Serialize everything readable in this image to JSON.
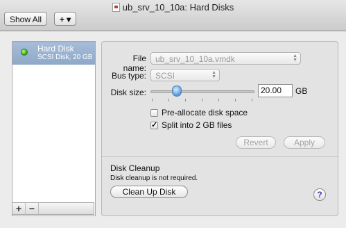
{
  "window": {
    "title": "ub_srv_10_10a: Hard Disks"
  },
  "toolbar": {
    "show_all_label": "Show All",
    "add_label": "+ ▾"
  },
  "sidebar": {
    "items": [
      {
        "name": "Hard Disk",
        "subtitle": "SCSI Disk, 20 GB",
        "status_color": "#3fae1d",
        "selected": true
      }
    ],
    "footer": {
      "add_label": "+",
      "remove_label": "−"
    }
  },
  "settings": {
    "file_name_label": "File name:",
    "file_name_value": "ub_srv_10_10a.vmdk",
    "bus_type_label": "Bus type:",
    "bus_type_value": "SCSI",
    "disk_size_label": "Disk size:",
    "disk_size_value": "20.00",
    "disk_size_unit": "GB",
    "disk_size_slider_fraction": 0.25,
    "preallocate_label": "Pre-allocate disk space",
    "preallocate_checked": false,
    "split_label": "Split into 2 GB files",
    "split_checked": true,
    "revert_label": "Revert",
    "apply_label": "Apply"
  },
  "cleanup": {
    "title": "Disk Cleanup",
    "status": "Disk cleanup is not required.",
    "button_label": "Clean Up Disk",
    "help_label": "?"
  },
  "colors": {
    "selection": "#8ea8c9",
    "help_accent": "#3b3ba0"
  }
}
